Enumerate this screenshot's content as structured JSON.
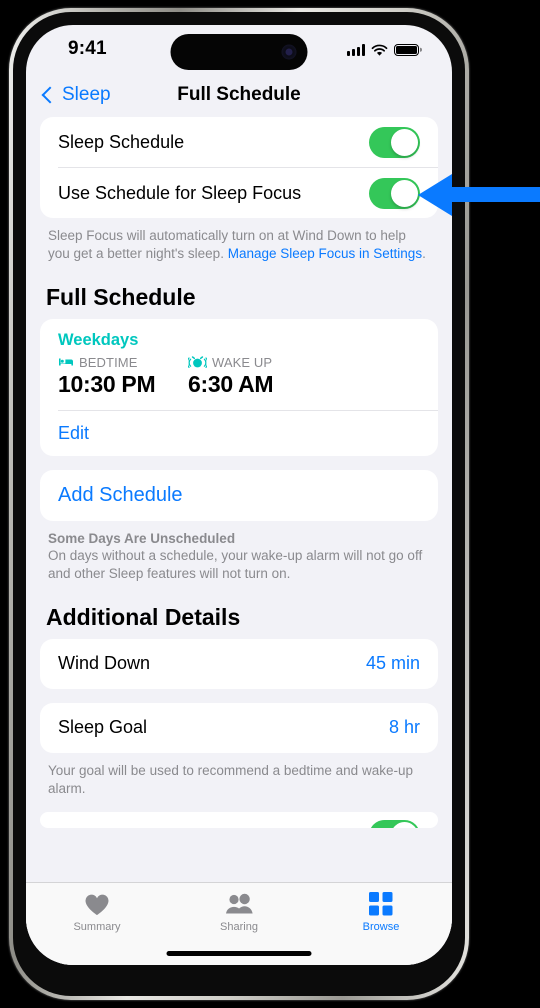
{
  "status_bar": {
    "time": "9:41",
    "cellular_icon": "cellular-bars-icon",
    "wifi_icon": "wifi-icon",
    "battery_icon": "battery-icon"
  },
  "nav": {
    "back_label": "Sleep",
    "back_icon": "chevron-left-icon",
    "title": "Full Schedule"
  },
  "settings_group": {
    "rows": [
      {
        "label": "Sleep Schedule",
        "toggle_on": true
      },
      {
        "label": "Use Schedule for Sleep Focus",
        "toggle_on": true
      }
    ],
    "footnote_before": "Sleep Focus will automatically turn on at Wind Down to help you get a better night's sleep. ",
    "footnote_link": "Manage Sleep Focus in Settings",
    "footnote_after": "."
  },
  "full_schedule": {
    "header": "Full Schedule",
    "schedule": {
      "days": "Weekdays",
      "bedtime_icon": "bed-icon",
      "bedtime_caption": "BEDTIME",
      "bedtime_value": "10:30 PM",
      "wakeup_icon": "alarm-clock-icon",
      "wakeup_caption": "WAKE UP",
      "wakeup_value": "6:30 AM",
      "edit_label": "Edit"
    },
    "add_schedule_label": "Add Schedule",
    "unscheduled_title": "Some Days Are Unscheduled",
    "unscheduled_body": "On days without a schedule, your wake-up alarm will not go off and other Sleep features will not turn on."
  },
  "additional_details": {
    "header": "Additional Details",
    "rows": [
      {
        "label": "Wind Down",
        "value": "45 min"
      },
      {
        "label": "Sleep Goal",
        "value": "8 hr"
      }
    ],
    "sleep_goal_footnote": "Your goal will be used to recommend a bedtime and wake-up alarm."
  },
  "tab_bar": {
    "tabs": [
      {
        "label": "Summary",
        "icon": "heart-icon",
        "active": false
      },
      {
        "label": "Sharing",
        "icon": "people-icon",
        "active": false
      },
      {
        "label": "Browse",
        "icon": "grid-squares-icon",
        "active": true
      }
    ]
  },
  "annotation": {
    "arrow_icon": "left-arrow-annotation",
    "arrow_color": "#0a7aff",
    "points_at": "Sleep Schedule"
  },
  "colors": {
    "accent_blue": "#0a7aff",
    "toggle_green": "#34c759",
    "teal": "#00c7be",
    "background": "#f2f2f7"
  }
}
